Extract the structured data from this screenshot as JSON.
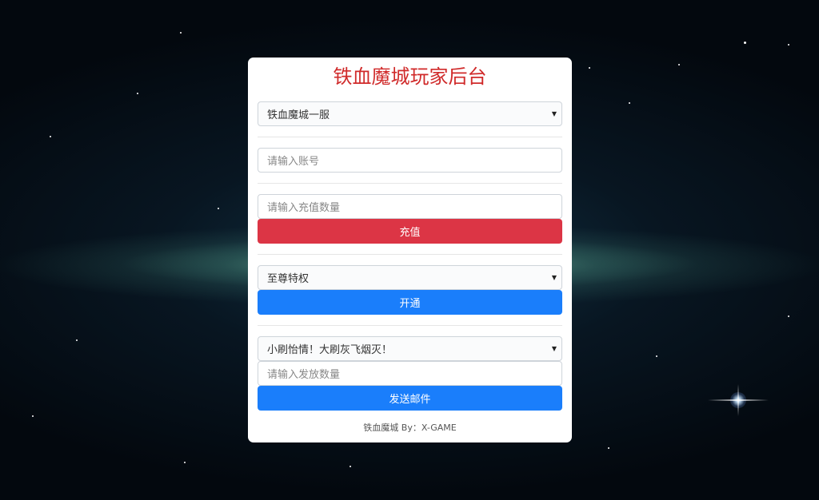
{
  "panel": {
    "title": "铁血魔城玩家后台",
    "server_select": {
      "value": "铁血魔城一服"
    },
    "account_input": {
      "placeholder": "请输入账号"
    },
    "recharge": {
      "amount_placeholder": "请输入充值数量",
      "button_label": "充值"
    },
    "privilege": {
      "select_value": "至尊特权",
      "button_label": "开通"
    },
    "mail": {
      "select_value": "小刷怡情！大刷灰飞烟灭！",
      "amount_placeholder": "请输入发放数量",
      "button_label": "发送邮件"
    },
    "footer": "铁血魔城 By：X-GAME"
  },
  "colors": {
    "title": "#d02a2a",
    "recharge_button": "#dc3545",
    "action_button": "#1a7efb",
    "panel_background": "#ffffff"
  },
  "icons": {
    "select_caret": "caret-down-icon"
  }
}
